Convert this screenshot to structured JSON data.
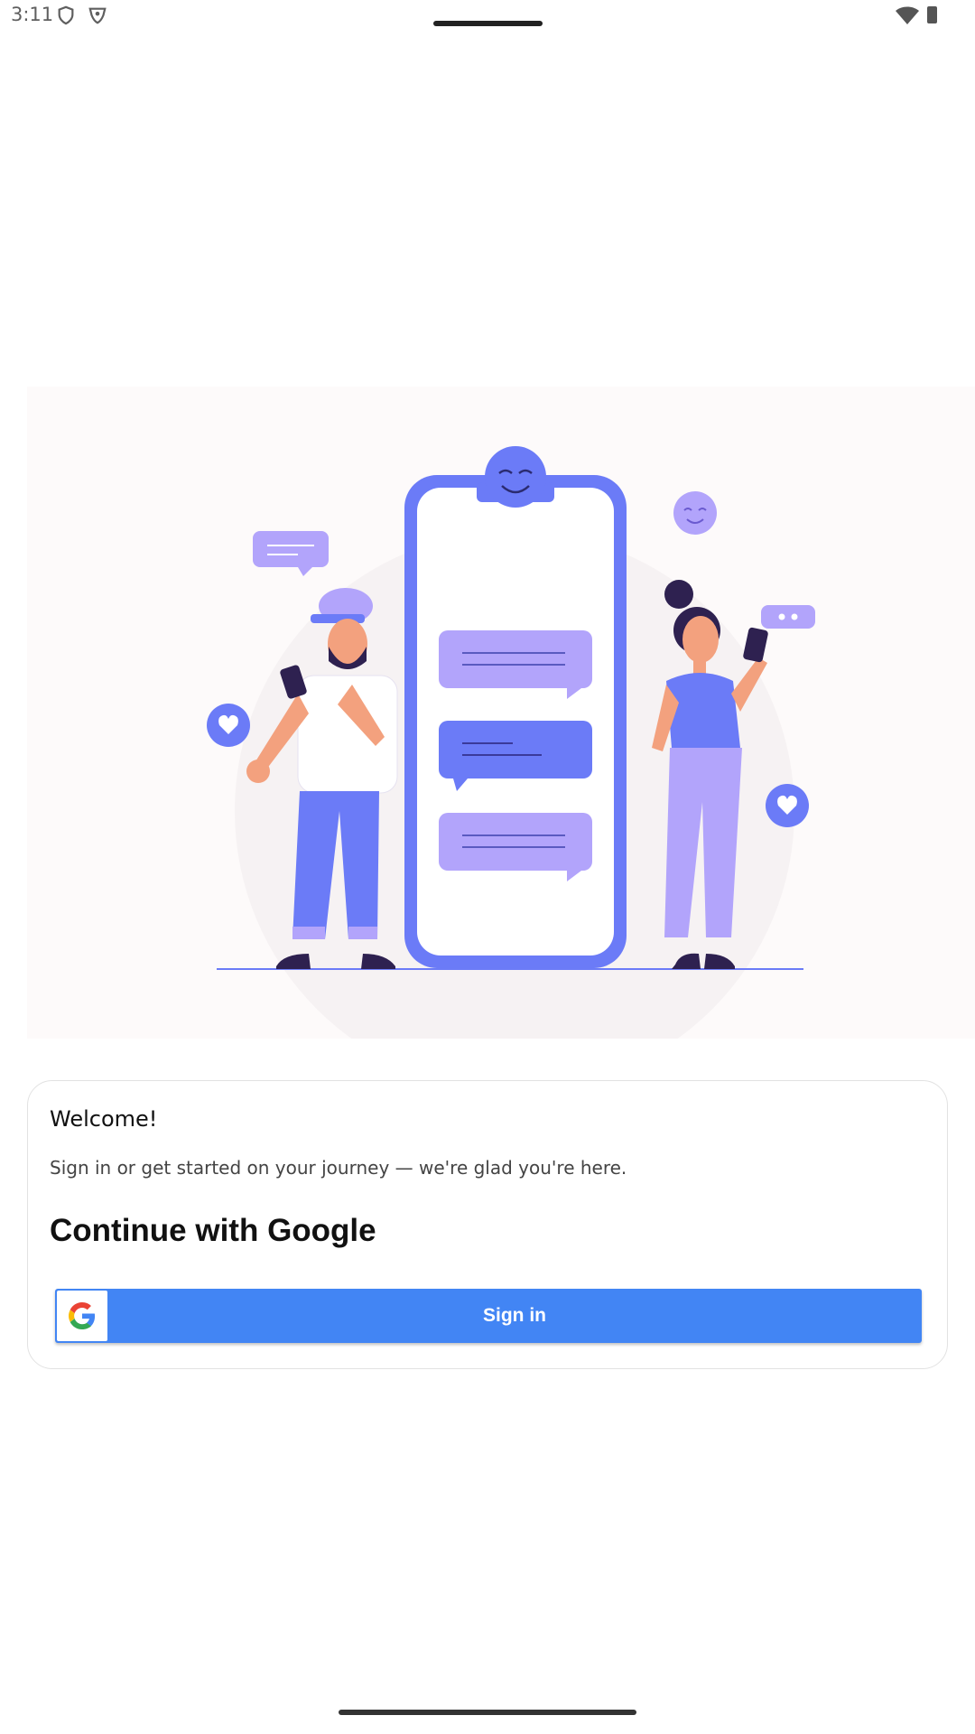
{
  "status_bar": {
    "time": "3:11",
    "icons": [
      "shield-icon",
      "vpn-icon",
      "wifi-icon",
      "battery-icon"
    ]
  },
  "illustration": {
    "description_icon": "people-chatting-illustration"
  },
  "card": {
    "welcome_title": "Welcome!",
    "welcome_subtitle": "Sign in or get started on your journey — we're glad you're here.",
    "continue_heading": "Continue with Google",
    "sign_in_label": "Sign in"
  },
  "colors": {
    "google_blue": "#4285f4",
    "illustration_primary": "#6b7bf7",
    "illustration_secondary": "#b2a4fb"
  }
}
